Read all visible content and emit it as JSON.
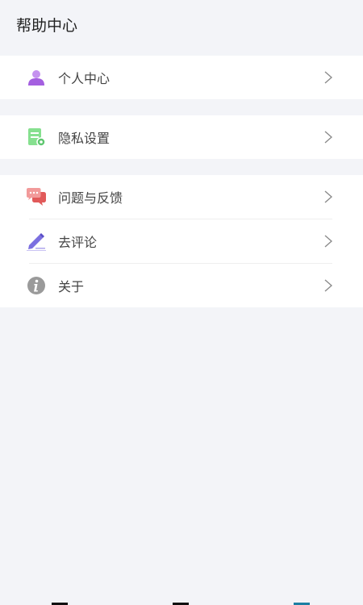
{
  "header": {
    "title": "帮助中心"
  },
  "groups": [
    {
      "items": [
        {
          "label": "个人中心",
          "icon": "user-icon"
        }
      ]
    },
    {
      "items": [
        {
          "label": "隐私设置",
          "icon": "privacy-settings-icon"
        }
      ]
    },
    {
      "items": [
        {
          "label": "问题与反馈",
          "icon": "chat-bubbles-icon"
        },
        {
          "label": "去评论",
          "icon": "pencil-icon"
        },
        {
          "label": "关于",
          "icon": "info-icon"
        }
      ]
    }
  ],
  "colors": {
    "background": "#f3f4f8",
    "card": "#ffffff",
    "user_icon": "#b77be8",
    "privacy_icon": "#7fdc8e",
    "feedback_icon": "#ee7d7d",
    "pencil_icon": "#7b6fe0",
    "info_icon": "#9a9a9a",
    "chevron": "#8a8a8a"
  }
}
